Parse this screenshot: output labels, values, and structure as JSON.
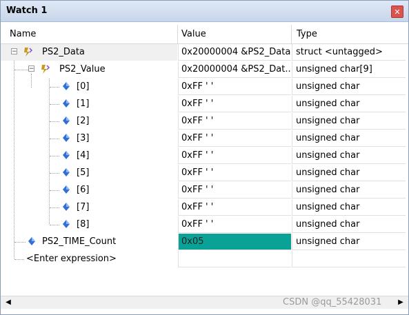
{
  "window": {
    "title": "Watch 1",
    "close_icon": "close-icon"
  },
  "columns": {
    "name": "Name",
    "value": "Value",
    "type": "Type"
  },
  "rows": [
    {
      "name": "PS2_Data",
      "value": "0x20000004 &PS2_Data",
      "type": "struct <untagged>"
    },
    {
      "name": "PS2_Value",
      "value": "0x20000004 &PS2_Dat...",
      "type": "unsigned char[9]"
    },
    {
      "name": "[0]",
      "value": "0xFF '   '",
      "type": "unsigned char"
    },
    {
      "name": "[1]",
      "value": "0xFF '   '",
      "type": "unsigned char"
    },
    {
      "name": "[2]",
      "value": "0xFF '   '",
      "type": "unsigned char"
    },
    {
      "name": "[3]",
      "value": "0xFF '   '",
      "type": "unsigned char"
    },
    {
      "name": "[4]",
      "value": "0xFF '   '",
      "type": "unsigned char"
    },
    {
      "name": "[5]",
      "value": "0xFF '   '",
      "type": "unsigned char"
    },
    {
      "name": "[6]",
      "value": "0xFF '   '",
      "type": "unsigned char"
    },
    {
      "name": "[7]",
      "value": "0xFF '   '",
      "type": "unsigned char"
    },
    {
      "name": "[8]",
      "value": "0xFF '   '",
      "type": "unsigned char"
    },
    {
      "name": "PS2_TIME_Count",
      "value": "0x05",
      "type": "unsigned char"
    }
  ],
  "enter_expression": "<Enter expression>",
  "watermark": "CSDN @qq_55428031",
  "colors": {
    "changed_value": "#0aa297",
    "struct_icon": "#c99a1a",
    "var_icon": "#2f6fd6"
  }
}
